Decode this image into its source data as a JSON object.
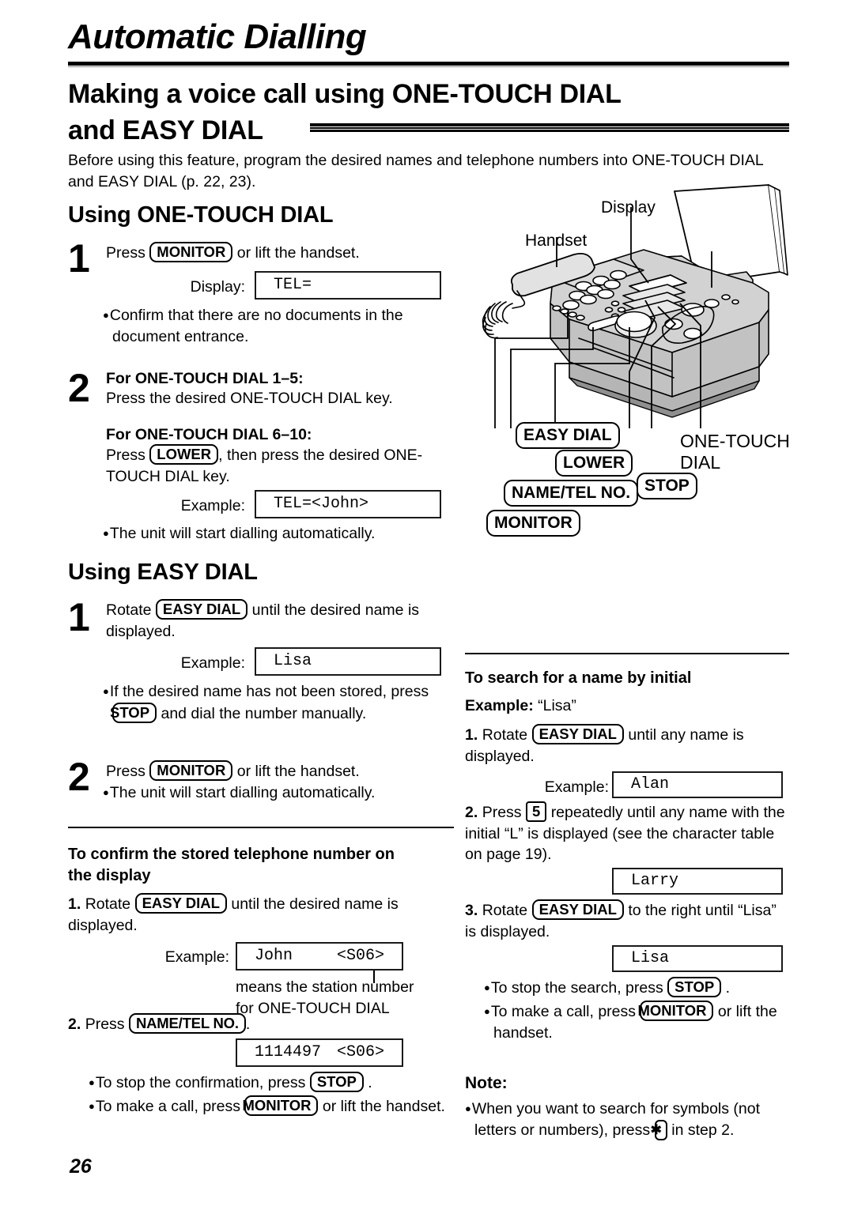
{
  "chapter": {
    "title": "Automatic Dialling"
  },
  "section": {
    "title_line1": "Making a voice call using ONE-TOUCH DIAL",
    "title_line2": "and EASY DIAL",
    "intro": "Before using this feature, program the desired names and telephone numbers into ONE-TOUCH DIAL and EASY DIAL (p. 22, 23)."
  },
  "illustration": {
    "label_display": "Display",
    "label_handset": "Handset",
    "callouts": {
      "easy_dial": "EASY DIAL",
      "lower": "LOWER",
      "name_tel_no": "NAME/TEL NO.",
      "monitor": "MONITOR",
      "stop": "STOP",
      "one_touch_dial_l1": "ONE-TOUCH",
      "one_touch_dial_l2": "DIAL"
    }
  },
  "one_touch": {
    "heading": "Using ONE-TOUCH DIAL",
    "step1": {
      "num": "1",
      "text_before": "Press",
      "key": "MONITOR",
      "text_after": "or lift the handset.",
      "display_label": "Display:",
      "display_value": "TEL=",
      "note": "Confirm that there are no documents in the document entrance."
    },
    "step2": {
      "num": "2",
      "sub1_heading": "For ONE-TOUCH DIAL 1–5:",
      "sub1_text": "Press the desired ONE-TOUCH DIAL key.",
      "sub2_heading": "For ONE-TOUCH DIAL 6–10:",
      "sub2_text_before": "Press",
      "sub2_key": "LOWER",
      "sub2_text_after": ", then press the desired ONE-TOUCH DIAL key.",
      "example_label": "Example:",
      "example_value": "TEL=<John>",
      "note": "The unit will start dialling automatically."
    }
  },
  "easy_dial": {
    "heading": "Using EASY DIAL",
    "step1": {
      "num": "1",
      "text_before": "Rotate",
      "key": "EASY DIAL",
      "text_after": "until the desired name is displayed.",
      "example_label": "Example:",
      "example_value": "Lisa",
      "note_before": "If the desired name has not been stored, press",
      "note_key": "STOP",
      "note_after": "and dial the number manually."
    },
    "step2": {
      "num": "2",
      "text_before": "Press",
      "key": "MONITOR",
      "text_after": "or lift the handset.",
      "note": "The unit will start dialling automatically."
    }
  },
  "confirm": {
    "heading_line1": "To confirm the stored telephone number on",
    "heading_line2": "the display",
    "item1_num": "1.",
    "item1_before": "Rotate",
    "item1_key": "EASY DIAL",
    "item1_after": "until the desired name is displayed.",
    "example_label": "Example:",
    "example_name": "John",
    "example_station": "<S06>",
    "caption_line1": "means the station number",
    "caption_line2": "for ONE-TOUCH DIAL",
    "item2_num": "2.",
    "item2_before": "Press",
    "item2_key": "NAME/TEL NO.",
    "item2_after": ".",
    "result_number": "1114497",
    "result_station": "<S06>",
    "note1_before": "To stop the confirmation, press",
    "note1_key": "STOP",
    "note1_after": ".",
    "note2_before": "To make a call, press",
    "note2_key": "MONITOR",
    "note2_after": "or lift the handset."
  },
  "search": {
    "heading": "To search for a name by initial",
    "example_label": "Example:",
    "example_value": "“Lisa”",
    "item1_num": "1.",
    "item1_before": "Rotate",
    "item1_key": "EASY DIAL",
    "item1_after": "until any name is displayed.",
    "example2_label": "Example:",
    "example2_value": "Alan",
    "item2_num": "2.",
    "item2_before": "Press",
    "item2_key": "5",
    "item2_after": "repeatedly until any name with the initial “L” is displayed (see the character table on page 19).",
    "result2_value": "Larry",
    "item3_num": "3.",
    "item3_before": "Rotate",
    "item3_key": "EASY DIAL",
    "item3_after": "to the right until “Lisa” is displayed.",
    "result3_value": "Lisa",
    "note1_before": "To stop the search, press",
    "note1_key": "STOP",
    "note1_after": ".",
    "note2_before": "To make a call, press",
    "note2_key": "MONITOR",
    "note2_after": "or lift the handset."
  },
  "note": {
    "heading": "Note:",
    "text_before": "When you want to search for symbols (not letters or numbers), press",
    "key": "✱",
    "text_after": "in step 2."
  },
  "footer": {
    "page_number": "26"
  }
}
